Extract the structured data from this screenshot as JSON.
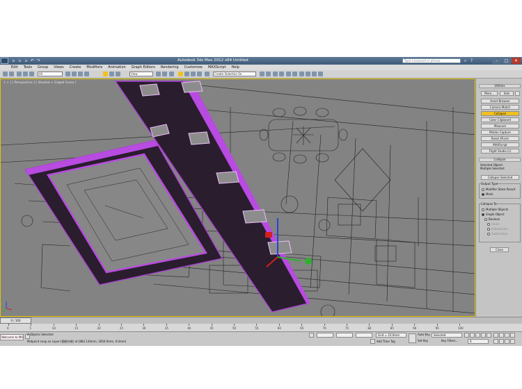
{
  "window": {
    "title": "Autodesk 3ds Max  2012 x64      Untitled",
    "help_search_placeholder": "Type a keyword or phrase"
  },
  "menu": [
    "Edit",
    "Tools",
    "Group",
    "Views",
    "Create",
    "Modifiers",
    "Animation",
    "Graph Editors",
    "Rendering",
    "Customize",
    "MAXScript",
    "Help"
  ],
  "toolbar": {
    "selection_filter": "All",
    "reference_coord": "View",
    "named_selection": "Create Selection Se"
  },
  "viewport": {
    "label": "[ + ] [ Perspective ] [ Shaded + Edged Faces ]"
  },
  "command_panel": {
    "title": "Utilities",
    "more_label": "More...",
    "sets_label": "Sets",
    "utilities": [
      "Asset Browser",
      "Camera Match",
      "Collapse",
      "Color Clipboard",
      "Measure",
      "Motion Capture",
      "Reset XForm",
      "MAXScript",
      "Flight Studio (c)"
    ],
    "active_utility": "Collapse",
    "collapse_rollout_title": "Collapse",
    "selected_object_label": "Selected Object:",
    "selected_object_value": "Multiple Selected",
    "collapse_selected_label": "Collapse Selected",
    "output_type_label": "Output Type",
    "output_options": [
      "Modifier Stack Result",
      "Mesh"
    ],
    "collapse_to_label": "Collapse To",
    "collapse_to_options": [
      "Multiple Objects",
      "Single Object"
    ],
    "boolean_label": "Boolean",
    "boolean_options": [
      "Union",
      "Intersection",
      "Subtraction"
    ],
    "close_label": "Close"
  },
  "timeline": {
    "frame_readout": "0 / 100",
    "ticks": [
      "0",
      "5",
      "10",
      "15",
      "20",
      "25",
      "30",
      "35",
      "40",
      "45",
      "50",
      "55",
      "60",
      "65",
      "70",
      "75",
      "80",
      "85",
      "90",
      "95",
      "100"
    ]
  },
  "status": {
    "maxscript_label": "Welcome to MAXScript.",
    "selection_status": "2 Objects Selected",
    "prompt": "Midpoint snap on Layer:(图纸外框) at [882.144mm, 1850.0mm, 0.0mm]",
    "grid": "Grid = 10.0mm",
    "add_time_tag": "Add Time Tag",
    "auto_key": "Auto Key",
    "set_key": "Set Key",
    "key_mode": "Selected",
    "key_filters": "Key Filters...",
    "current_frame": "0"
  }
}
